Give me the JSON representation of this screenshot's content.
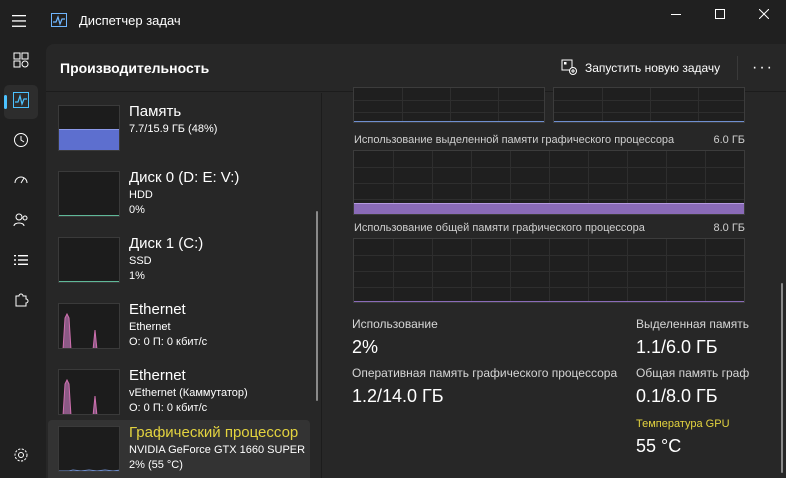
{
  "window": {
    "title": "Диспетчер задач"
  },
  "header": {
    "page_title": "Производительность",
    "run_task_label": "Запустить новую задачу",
    "more_label": "···"
  },
  "nav": [
    {
      "name": "processes",
      "icon": "grid-icon"
    },
    {
      "name": "performance",
      "icon": "activity-icon",
      "active": true
    },
    {
      "name": "app-history",
      "icon": "history-icon"
    },
    {
      "name": "startup",
      "icon": "speedometer-icon"
    },
    {
      "name": "users",
      "icon": "users-icon"
    },
    {
      "name": "details",
      "icon": "list-icon"
    },
    {
      "name": "services",
      "icon": "puzzle-icon"
    },
    {
      "name": "settings",
      "icon": "gear-icon"
    }
  ],
  "devices": [
    {
      "name": "Память",
      "line1": "7.7/15.9 ГБ (48%)",
      "line2": "",
      "usage": 0.48
    },
    {
      "name": "Диск 0 (D: E: V:)",
      "line1": "HDD",
      "line2": "0%"
    },
    {
      "name": "Диск 1 (C:)",
      "line1": "SSD",
      "line2": "1%"
    },
    {
      "name": "Ethernet",
      "line1": "Ethernet",
      "line2": "О: 0 П: 0 кбит/с"
    },
    {
      "name": "Ethernet",
      "line1": "vEthernet (Каммутатор)",
      "line2": "О: 0 П: 0 кбит/с"
    },
    {
      "name": "Графический процессор",
      "line1": "NVIDIA GeForce GTX 1660 SUPER",
      "line2": "2%  (55 °C)",
      "selected": true
    }
  ],
  "gpu": {
    "dedicated_title": "Использование выделенной памяти графического процессора",
    "dedicated_max": "6.0 ГБ",
    "dedicated_fill": 0.18,
    "shared_title": "Использование общей памяти графического процессора",
    "shared_max": "8.0 ГБ",
    "stats": {
      "usage_label": "Использование",
      "usage_value": "2%",
      "dedicated_label": "Выделенная память",
      "dedicated_value": "1.1/6.0 ГБ",
      "ram_label": "Оперативная память графического процессора",
      "ram_value": "1.2/14.0 ГБ",
      "shared_label": "Общая память граф",
      "shared_value": "0.1/8.0 ГБ",
      "temp_label": "Температура GPU",
      "temp_value": "55 °C"
    }
  },
  "colors": {
    "accent_blue": "#4cc2ff",
    "memory_fill": "#5d6fcf",
    "network_line": "#d070b0",
    "gpu_memory_fill": "#8a6bb8",
    "selected_text": "#e3d33f"
  }
}
